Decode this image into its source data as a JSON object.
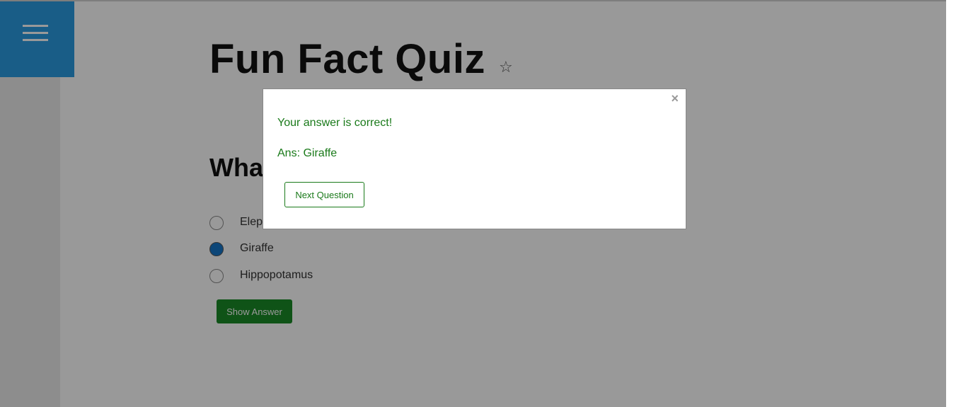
{
  "page": {
    "title": "Fun Fact Quiz",
    "star_icon": "star-outline-icon",
    "menu_icon": "hamburger-menu-icon",
    "accent_color": "#2b9ce2"
  },
  "question": {
    "text_visible": "Wha",
    "options": [
      {
        "label": "Elep",
        "selected": false
      },
      {
        "label": "Giraffe",
        "selected": true
      },
      {
        "label": "Hippopotamus",
        "selected": false
      }
    ],
    "show_answer_label": "Show Answer"
  },
  "modal": {
    "message": "Your answer is correct!",
    "answer": "Ans: Giraffe",
    "next_label": "Next Question",
    "close_glyph": "×",
    "text_color": "#1a7a1a"
  }
}
